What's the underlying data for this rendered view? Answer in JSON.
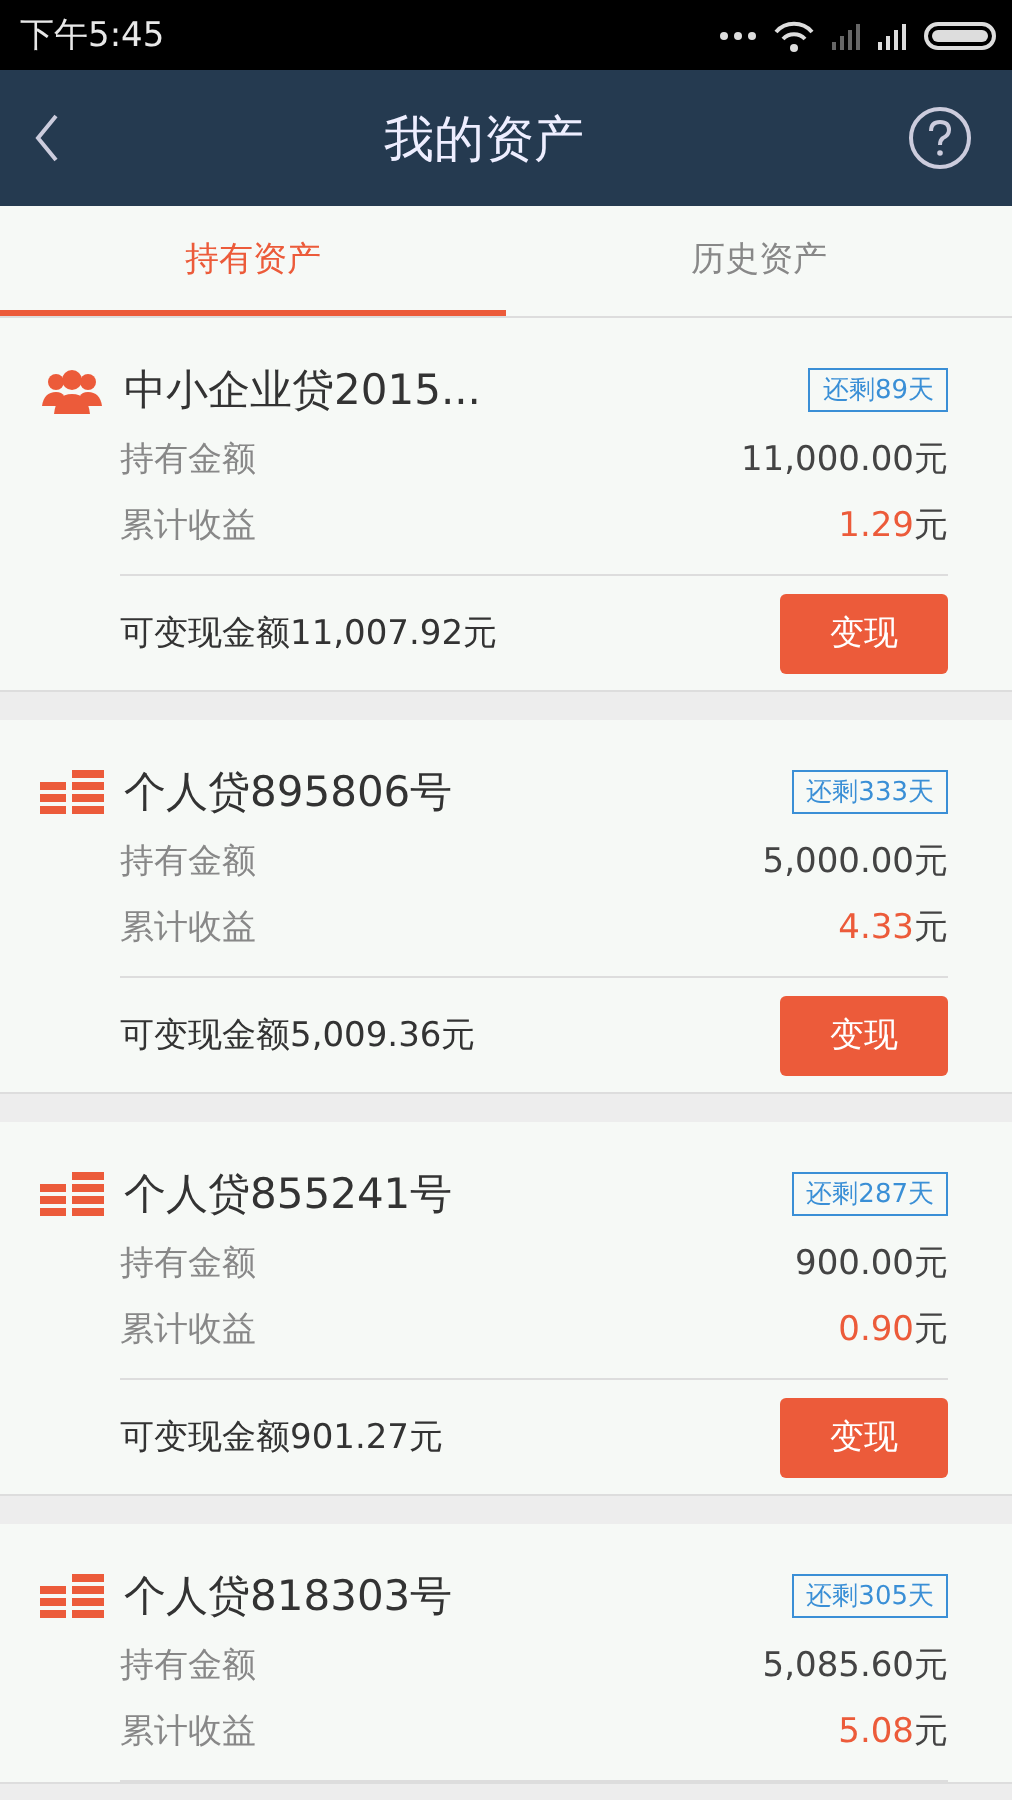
{
  "status_bar": {
    "time": "下午5:45"
  },
  "header": {
    "title": "我的资产"
  },
  "tabs": [
    {
      "label": "持有资产",
      "selected": true
    },
    {
      "label": "历史资产",
      "selected": false
    }
  ],
  "assets": [
    {
      "kind": "enterprise",
      "name": "中小企业贷2015...",
      "remaining": "还剩89天",
      "holding_label": "持有金额",
      "holding": "11,000.00元",
      "earnings_label": "累计收益",
      "earnings": "1.29",
      "earnings_unit": "元",
      "redeemable": "可变现金额11,007.92元",
      "action": "变现"
    },
    {
      "kind": "personal",
      "name": "个人贷895806号",
      "remaining": "还剩333天",
      "holding_label": "持有金额",
      "holding": "5,000.00元",
      "earnings_label": "累计收益",
      "earnings": "4.33",
      "earnings_unit": "元",
      "redeemable": "可变现金额5,009.36元",
      "action": "变现"
    },
    {
      "kind": "personal",
      "name": "个人贷855241号",
      "remaining": "还剩287天",
      "holding_label": "持有金额",
      "holding": "900.00元",
      "earnings_label": "累计收益",
      "earnings": "0.90",
      "earnings_unit": "元",
      "redeemable": "可变现金额901.27元",
      "action": "变现"
    },
    {
      "kind": "personal",
      "name": "个人贷818303号",
      "remaining": "还剩305天",
      "holding_label": "持有金额",
      "holding": "5,085.60元",
      "earnings_label": "累计收益",
      "earnings": "5.08",
      "earnings_unit": "元"
    }
  ]
}
